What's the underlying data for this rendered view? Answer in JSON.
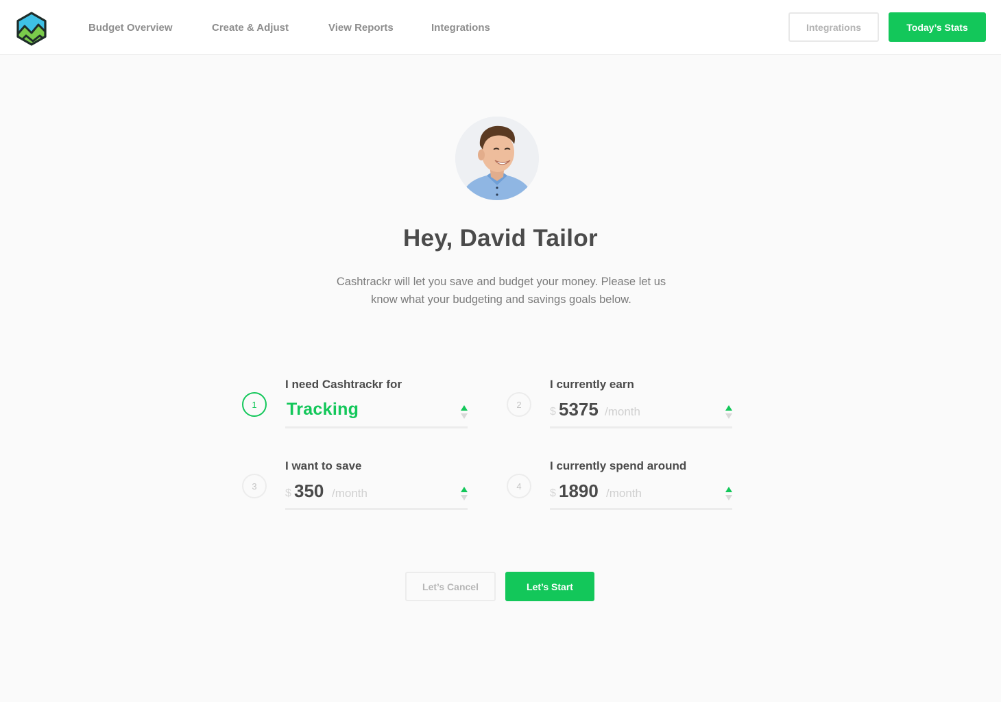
{
  "header": {
    "nav": [
      "Budget Overview",
      "Create & Adjust",
      "View Reports",
      "Integrations"
    ],
    "integrations_button": "Integrations",
    "stats_button": "Today’s Stats"
  },
  "logo": {
    "icon": "mountain-hexagon-icon",
    "colors": [
      "#3ec1e6",
      "#7acb4b",
      "#1f2d2a"
    ]
  },
  "profile": {
    "greeting": "Hey, David Tailor",
    "intro": "Cashtrackr will let you save and budget your money. Please let us know what your budgeting and savings goals below."
  },
  "form": {
    "fields": [
      {
        "step": "1",
        "label": "I need Cashtrackr for",
        "value": "Tracking"
      },
      {
        "step": "2",
        "label": "I currently earn",
        "currency": "$",
        "value": "5375",
        "unit": "/month"
      },
      {
        "step": "3",
        "label": "I want to save",
        "currency": "$",
        "value": "350",
        "unit": "/month"
      },
      {
        "step": "4",
        "label": "I currently spend around",
        "currency": "$",
        "value": "1890",
        "unit": "/month"
      }
    ],
    "cancel_button": "Let’s Cancel",
    "start_button": "Let’s Start"
  },
  "colors": {
    "accent": "#13c75a",
    "background": "#fafafa",
    "text": "#4a4a4a",
    "muted": "#8e8e8e"
  }
}
